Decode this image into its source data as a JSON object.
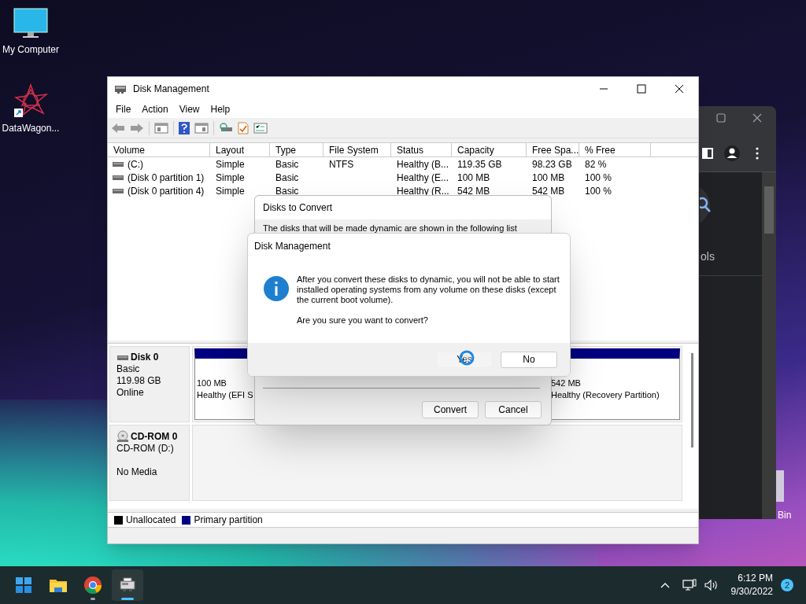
{
  "desktop_icons": [
    {
      "kind": "computer",
      "label": "My Computer"
    },
    {
      "kind": "shortcut",
      "label": "DataWagon..."
    }
  ],
  "background_window": {
    "partial_text": "ols"
  },
  "recycle_bin": {
    "label": "Bin"
  },
  "disk_management": {
    "title": "Disk Management",
    "menu": [
      "File",
      "Action",
      "View",
      "Help"
    ],
    "volume_table": {
      "columns": [
        "Volume",
        "Layout",
        "Type",
        "File System",
        "Status",
        "Capacity",
        "Free Spa...",
        "% Free"
      ],
      "rows": [
        [
          "(C:)",
          "Simple",
          "Basic",
          "NTFS",
          "Healthy (B...",
          "119.35 GB",
          "98.23 GB",
          "82 %"
        ],
        [
          "(Disk 0 partition 1)",
          "Simple",
          "Basic",
          "",
          "Healthy (E...",
          "100 MB",
          "100 MB",
          "100 %"
        ],
        [
          "(Disk 0 partition 4)",
          "Simple",
          "Basic",
          "",
          "Healthy (R...",
          "542 MB",
          "542 MB",
          "100 %"
        ]
      ]
    },
    "disks": [
      {
        "kind": "disk",
        "name": "Disk 0",
        "type": "Basic",
        "size": "119.98 GB",
        "status": "Online",
        "partitions": [
          {
            "size": "100 MB",
            "status": "Healthy (EFI S"
          },
          {
            "size": "542 MB",
            "status": "Healthy (Recovery Partition)"
          }
        ]
      },
      {
        "kind": "cdrom",
        "name": "CD-ROM 0",
        "type": "CD-ROM (D:)",
        "status": "No Media"
      }
    ],
    "legend": [
      {
        "label": "Unallocated",
        "color": "#000000"
      },
      {
        "label": "Primary partition",
        "color": "#000080"
      }
    ]
  },
  "convert_dialog": {
    "title": "Disks to Convert",
    "text": "The disks that will be made dynamic are shown in the following list",
    "buttons": [
      "Convert",
      "Cancel"
    ]
  },
  "message_box": {
    "title": "Disk Management",
    "message": "After you convert these disks to dynamic, you will not be able to start installed operating systems from any volume on these disks (except the current boot volume).",
    "question": "Are you sure you want to convert?",
    "buttons": [
      "Yes",
      "No"
    ]
  },
  "taskbar": {
    "apps": [
      {
        "kind": "start",
        "running": false,
        "selected": false
      },
      {
        "kind": "folder",
        "running": false,
        "selected": false
      },
      {
        "kind": "chrome",
        "running": true,
        "selected": false
      },
      {
        "kind": "disk",
        "running": true,
        "selected": true
      }
    ],
    "clock": {
      "time": "6:12 PM",
      "date": "9/30/2022"
    },
    "notification_count": "2"
  }
}
